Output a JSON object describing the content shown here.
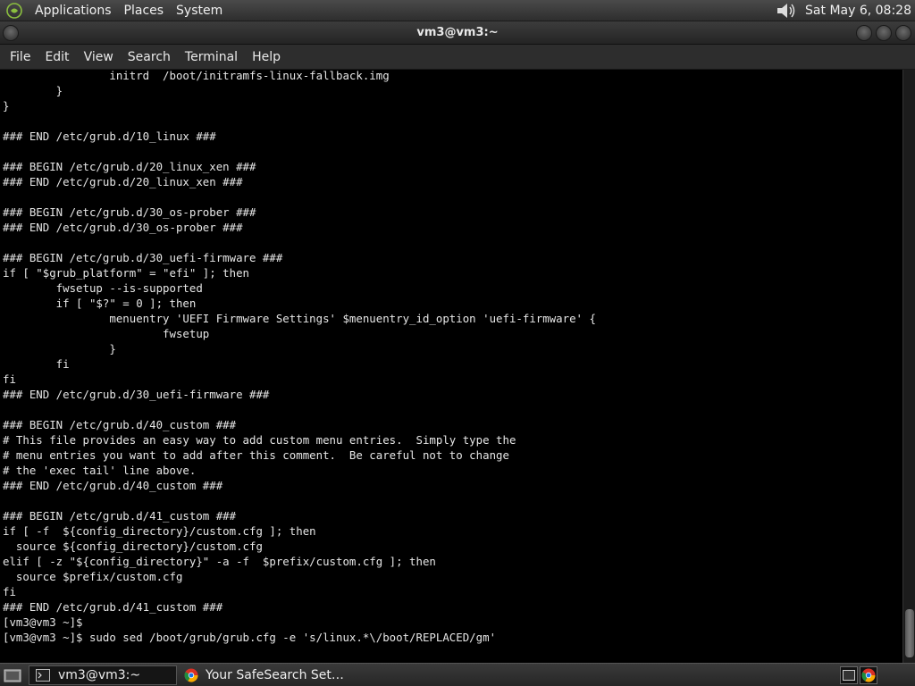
{
  "top_panel": {
    "menus": [
      "Applications",
      "Places",
      "System"
    ],
    "clock": "Sat May  6, 08:28"
  },
  "window": {
    "title": "vm3@vm3:~"
  },
  "menubar": {
    "items": [
      "File",
      "Edit",
      "View",
      "Search",
      "Terminal",
      "Help"
    ]
  },
  "terminal": {
    "lines": [
      "                initrd  /boot/initramfs-linux-fallback.img",
      "        }",
      "}",
      "",
      "### END /etc/grub.d/10_linux ###",
      "",
      "### BEGIN /etc/grub.d/20_linux_xen ###",
      "### END /etc/grub.d/20_linux_xen ###",
      "",
      "### BEGIN /etc/grub.d/30_os-prober ###",
      "### END /etc/grub.d/30_os-prober ###",
      "",
      "### BEGIN /etc/grub.d/30_uefi-firmware ###",
      "if [ \"$grub_platform\" = \"efi\" ]; then",
      "        fwsetup --is-supported",
      "        if [ \"$?\" = 0 ]; then",
      "                menuentry 'UEFI Firmware Settings' $menuentry_id_option 'uefi-firmware' {",
      "                        fwsetup",
      "                }",
      "        fi",
      "fi",
      "### END /etc/grub.d/30_uefi-firmware ###",
      "",
      "### BEGIN /etc/grub.d/40_custom ###",
      "# This file provides an easy way to add custom menu entries.  Simply type the",
      "# menu entries you want to add after this comment.  Be careful not to change",
      "# the 'exec tail' line above.",
      "### END /etc/grub.d/40_custom ###",
      "",
      "### BEGIN /etc/grub.d/41_custom ###",
      "if [ -f  ${config_directory}/custom.cfg ]; then",
      "  source ${config_directory}/custom.cfg",
      "elif [ -z \"${config_directory}\" -a -f  $prefix/custom.cfg ]; then",
      "  source $prefix/custom.cfg",
      "fi",
      "### END /etc/grub.d/41_custom ###",
      "[vm3@vm3 ~]$",
      "[vm3@vm3 ~]$ sudo sed /boot/grub/grub.cfg -e 's/linux.*\\/boot/REPLACED/gm'"
    ]
  },
  "taskbar": {
    "tasks": [
      {
        "label": "vm3@vm3:~",
        "icon": "terminal-icon",
        "active": true
      },
      {
        "label": "Your SafeSearch Set…",
        "icon": "chrome-icon",
        "active": false
      }
    ]
  },
  "colors": {
    "panel": "#2e2e2e",
    "terminal_bg": "#000000",
    "terminal_fg": "#e6e6e6"
  }
}
